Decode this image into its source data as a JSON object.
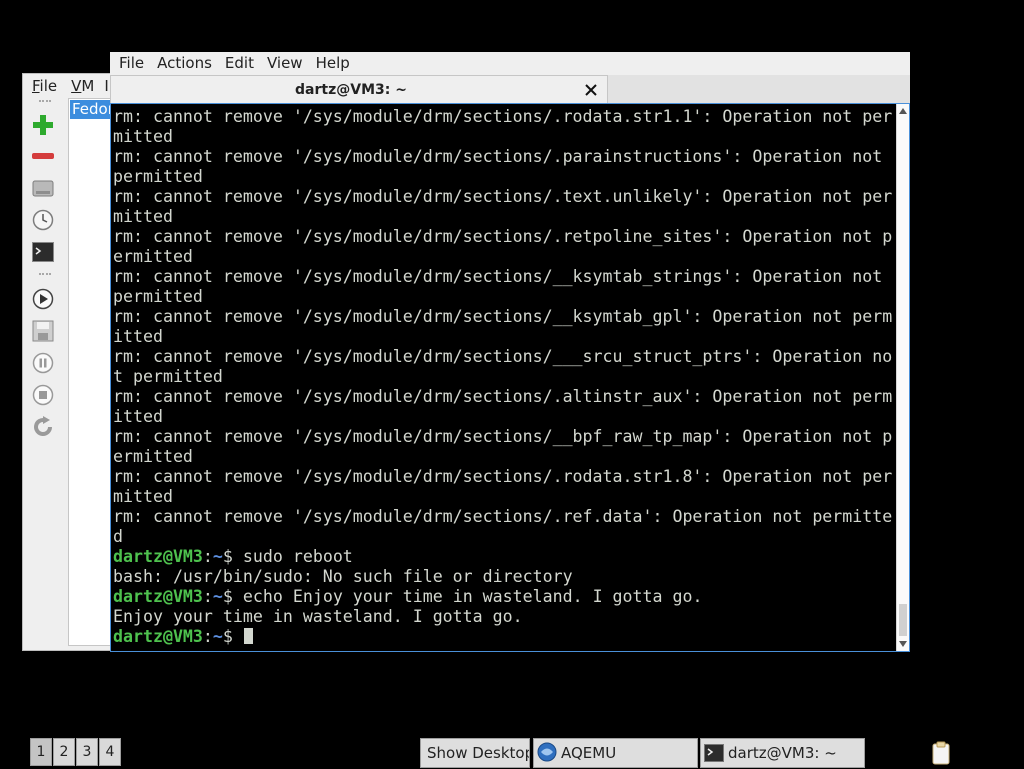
{
  "aqemu": {
    "menu": [
      {
        "label": "File",
        "u": "F",
        "rest": "ile"
      },
      {
        "label": "VM",
        "u": "V",
        "rest": "M"
      },
      {
        "label": "I",
        "u": "",
        "rest": "I"
      }
    ],
    "toolbar_icons": [
      "add-icon",
      "remove-icon",
      "disk-icon",
      "clock-icon",
      "terminal-icon",
      "play-icon",
      "save-icon",
      "pause-icon",
      "stop-icon",
      "reload-icon"
    ],
    "vm_list": [
      "Fedor"
    ],
    "colors": {
      "add": "#2eaa2e",
      "remove": "#d43c3c",
      "selection": "#3c8dde"
    }
  },
  "terminal": {
    "menu": [
      "File",
      "Actions",
      "Edit",
      "View",
      "Help"
    ],
    "tab_title": "dartz@VM3: ~",
    "prompt": {
      "user": "dartz@VM3",
      "sep": ":",
      "path": "~",
      "dollar": "$ "
    },
    "output_lines": [
      "rm: cannot remove '/sys/module/drm/sections/.rodata.str1.1': Operation not per",
      "mitted",
      "rm: cannot remove '/sys/module/drm/sections/.parainstructions': Operation not ",
      "permitted",
      "rm: cannot remove '/sys/module/drm/sections/.text.unlikely': Operation not per",
      "mitted",
      "rm: cannot remove '/sys/module/drm/sections/.retpoline_sites': Operation not p",
      "ermitted",
      "rm: cannot remove '/sys/module/drm/sections/__ksymtab_strings': Operation not ",
      "permitted",
      "rm: cannot remove '/sys/module/drm/sections/__ksymtab_gpl': Operation not perm",
      "itted",
      "rm: cannot remove '/sys/module/drm/sections/___srcu_struct_ptrs': Operation no",
      "t permitted",
      "rm: cannot remove '/sys/module/drm/sections/.altinstr_aux': Operation not perm",
      "itted",
      "rm: cannot remove '/sys/module/drm/sections/__bpf_raw_tp_map': Operation not p",
      "ermitted",
      "rm: cannot remove '/sys/module/drm/sections/.rodata.str1.8': Operation not per",
      "mitted",
      "rm: cannot remove '/sys/module/drm/sections/.ref.data': Operation not permitte",
      "d"
    ],
    "session": [
      {
        "type": "cmd",
        "text": "sudo reboot"
      },
      {
        "type": "out",
        "text": "bash: /usr/bin/sudo: No such file or directory"
      },
      {
        "type": "cmd",
        "text": "echo Enjoy your time in wasteland. I gotta go."
      },
      {
        "type": "out",
        "text": "Enjoy your time in wasteland. I gotta go."
      },
      {
        "type": "prompt",
        "text": ""
      }
    ],
    "colors": {
      "bg": "#000000",
      "text": "#d3d7cf",
      "user": "#4ec24e",
      "path": "#5c8fe0",
      "focus_border": "#4a90d9"
    }
  },
  "panel": {
    "workspaces": [
      "1",
      "2",
      "3",
      "4"
    ],
    "active_workspace": "1",
    "tasks": [
      {
        "label": "Show Desktop",
        "icon": ""
      },
      {
        "label": "AQEMU",
        "icon": "aqemu-icon"
      },
      {
        "label": "dartz@VM3: ~",
        "icon": "terminal-icon"
      }
    ],
    "tray_icons": [
      "clipboard-icon"
    ]
  }
}
